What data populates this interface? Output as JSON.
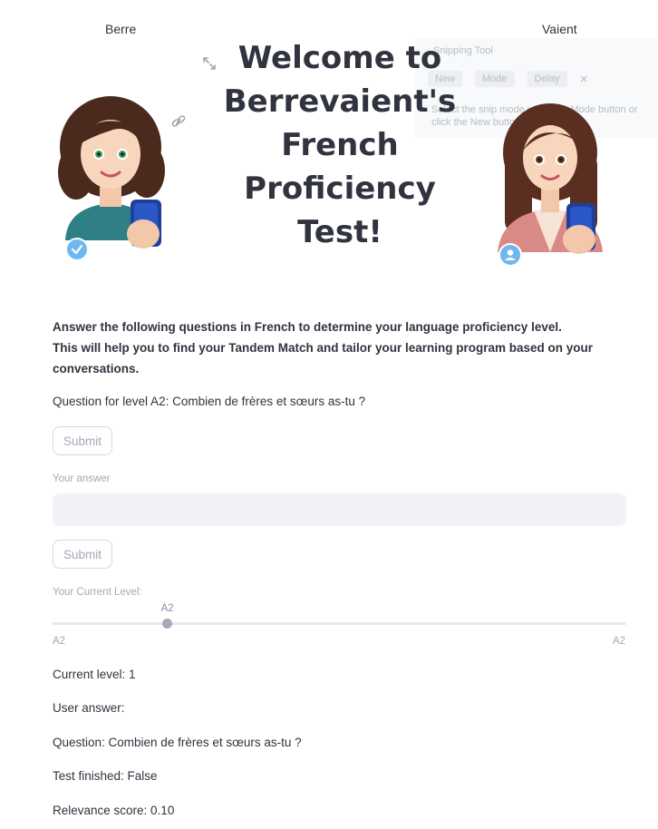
{
  "header": {
    "left_avatar_name": "Berre",
    "right_avatar_name": "Vaient",
    "title_lines": [
      "Welcome to",
      "Berrevaient's",
      "French",
      "Proficiency Test!"
    ]
  },
  "overlay": {
    "window_title": "Snipping Tool",
    "new_label": "New",
    "mode_label": "Mode",
    "delay_label": "Delay",
    "hint_text": "Select the snip mode using the Mode button or click the New button."
  },
  "intro": {
    "line1": "Answer the following questions in French to determine your language proficiency level.",
    "line2": "This will help you to find your Tandem Match and tailor your learning program based on your conversations."
  },
  "question": {
    "text": "Question for level A2: Combien de frères et sœurs as-tu ?"
  },
  "form": {
    "submit_top_label": "Submit",
    "answer_label": "Your answer",
    "answer_value": "",
    "submit_label": "Submit"
  },
  "slider": {
    "label": "Your Current Level:",
    "value_label": "A2",
    "min_label": "A2",
    "max_label": "A2",
    "fraction": 0.2
  },
  "status": {
    "current_level": "Current level: 1",
    "user_answer": "User answer:",
    "question": "Question: Combien de frères et sœurs as-tu ?",
    "test_finished": "Test finished: False",
    "relevance_score": "Relevance score: 0.10"
  },
  "colors": {
    "accent_check": "#6fb7f0",
    "left_shirt": "#2f7f86",
    "right_jacket": "#d98a86"
  }
}
